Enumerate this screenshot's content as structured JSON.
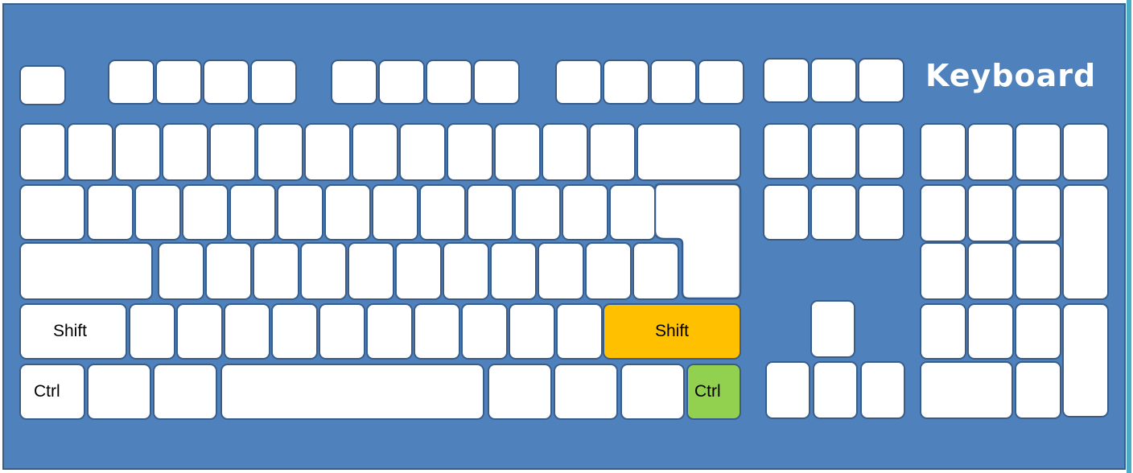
{
  "title": "Keyboard",
  "labels": {
    "left_shift": "Shift",
    "right_shift": "Shift",
    "left_ctrl": "Ctrl",
    "right_ctrl": "Ctrl"
  },
  "colors": {
    "board": "#4f81bd",
    "key": "#ffffff",
    "key_outline": "#385d8a",
    "right_shift_highlight": "#ffc000",
    "right_ctrl_highlight": "#92d050"
  }
}
